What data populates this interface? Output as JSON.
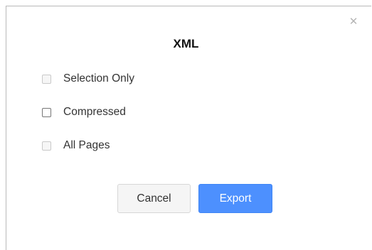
{
  "dialog": {
    "title": "XML",
    "close_icon": "close-icon",
    "close_glyph": "✕",
    "options": [
      {
        "label": "Selection Only",
        "checked": false,
        "disabled": true
      },
      {
        "label": "Compressed",
        "checked": false,
        "disabled": false
      },
      {
        "label": "All Pages",
        "checked": false,
        "disabled": true
      }
    ],
    "buttons": {
      "cancel_label": "Cancel",
      "export_label": "Export"
    }
  },
  "colors": {
    "primary_button": "#4d90fe",
    "border": "#b9b9b9"
  }
}
